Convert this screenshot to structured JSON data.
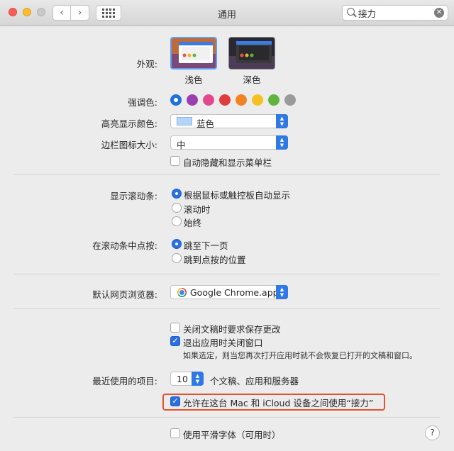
{
  "window": {
    "title": "通用"
  },
  "search": {
    "value": "接力"
  },
  "appearance": {
    "label": "外观:",
    "options": [
      {
        "label": "浅色",
        "selected": true
      },
      {
        "label": "深色",
        "selected": false
      }
    ]
  },
  "accent": {
    "label": "强调色:",
    "colors": [
      "#1f6fde",
      "#9b3fb0",
      "#e3488f",
      "#e03c3c",
      "#f28322",
      "#f6c023",
      "#5fb43f",
      "#9a9a9a"
    ],
    "selected_index": 0
  },
  "highlight": {
    "label": "高亮显示颜色:",
    "value": "蓝色",
    "swatch": "#b4d4fb"
  },
  "sidebar_icon_size": {
    "label": "边栏图标大小:",
    "value": "中"
  },
  "auto_hide_menu": {
    "label": "自动隐藏和显示菜单栏",
    "checked": false
  },
  "scroll_bars": {
    "label": "显示滚动条:",
    "options": [
      {
        "label": "根据鼠标或触控板自动显示",
        "selected": true
      },
      {
        "label": "滚动时",
        "selected": false
      },
      {
        "label": "始终",
        "selected": false
      }
    ]
  },
  "scroll_click": {
    "label": "在滚动条中点按:",
    "options": [
      {
        "label": "跳至下一页",
        "selected": true
      },
      {
        "label": "跳到点按的位置",
        "selected": false
      }
    ]
  },
  "browser": {
    "label": "默认网页浏览器:",
    "value": "Google Chrome.app"
  },
  "ask_save": {
    "label": "关闭文稿时要求保存更改",
    "checked": false
  },
  "close_windows": {
    "label": "退出应用时关闭窗口",
    "checked": true
  },
  "close_windows_note": "如果选定，则当您再次打开应用时就不会恢复已打开的文稿和窗口。",
  "recent_items": {
    "label": "最近使用的项目:",
    "value": "10",
    "suffix": "个文稿、应用和服务器"
  },
  "handoff": {
    "label": "允许在这台 Mac 和 iCloud 设备之间使用“接力”",
    "checked": true,
    "outline_color": "#e4532f"
  },
  "font_smoothing": {
    "label": "使用平滑字体（可用时）",
    "checked": false
  },
  "help": {
    "label": "?"
  }
}
